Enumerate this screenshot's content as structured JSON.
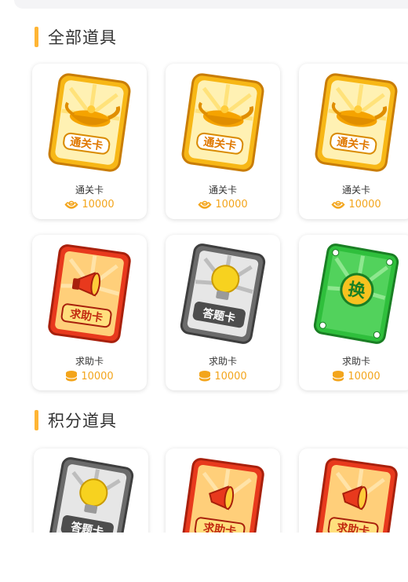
{
  "sections": {
    "all_props": {
      "title": "全部道具"
    },
    "points_props": {
      "title": "积分道具"
    }
  },
  "cards": [
    {
      "name": "通关卡",
      "price": "10000",
      "currency_icon": "ingot-icon",
      "card_icon": "pass-card-icon",
      "art_text": "通关卡"
    },
    {
      "name": "通关卡",
      "price": "10000",
      "currency_icon": "ingot-icon",
      "card_icon": "pass-card-icon",
      "art_text": "通关卡"
    },
    {
      "name": "通关卡",
      "price": "10000",
      "currency_icon": "ingot-icon",
      "card_icon": "pass-card-icon",
      "art_text": "通关卡"
    },
    {
      "name": "求助卡",
      "price": "10000",
      "currency_icon": "coin-stack-icon",
      "card_icon": "help-card-icon",
      "art_text": "求助卡"
    },
    {
      "name": "求助卡",
      "price": "10000",
      "currency_icon": "coin-stack-icon",
      "card_icon": "answer-card-icon",
      "art_text": "答题卡"
    },
    {
      "name": "求助卡",
      "price": "10000",
      "currency_icon": "coin-stack-icon",
      "card_icon": "swap-card-icon",
      "art_text": "换"
    }
  ],
  "points_cards": [
    {
      "card_icon": "answer-card-icon",
      "art_text": "答题卡"
    },
    {
      "card_icon": "help-card-icon",
      "art_text": "求助卡"
    },
    {
      "card_icon": "help-card-icon",
      "art_text": "求助卡"
    }
  ],
  "colors": {
    "accent": "#ffb534",
    "price": "#f3a51c",
    "text": "#333333"
  }
}
